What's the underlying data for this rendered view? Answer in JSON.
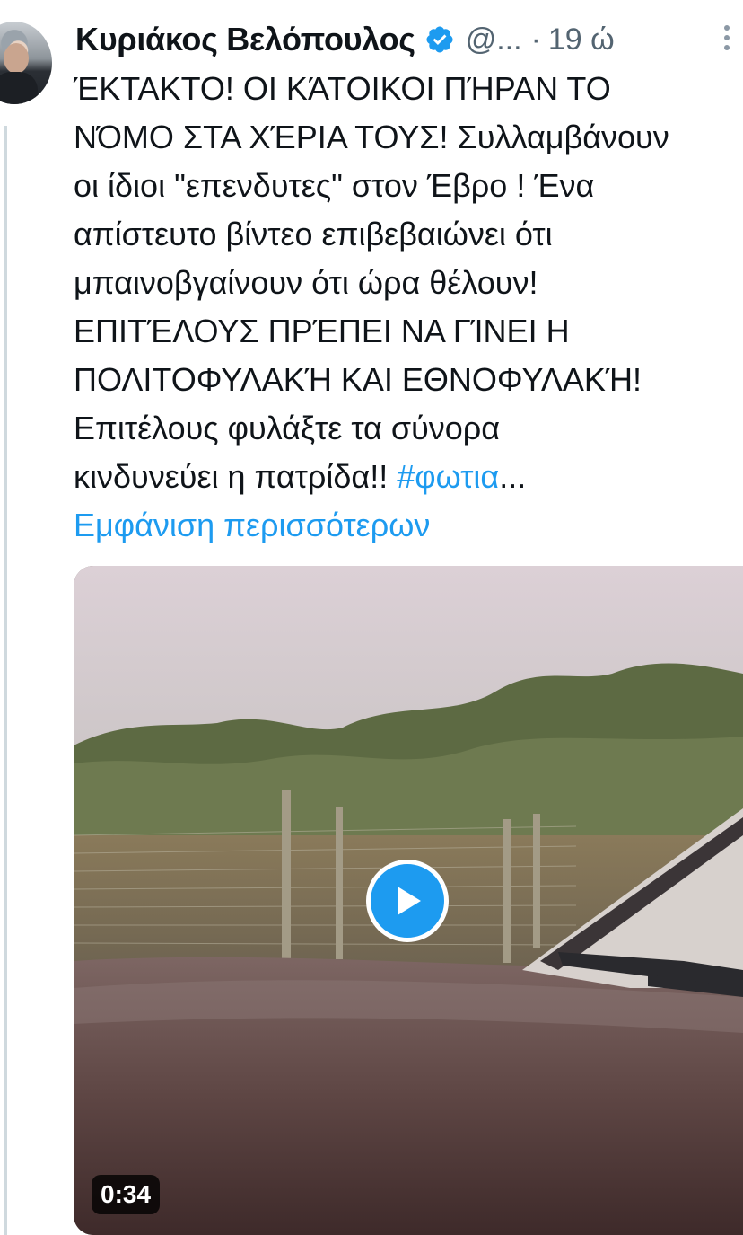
{
  "author": {
    "name": "Κυριάκος Βελόπουλος",
    "handle": "@...",
    "separator": "·",
    "time": "19 ώ",
    "verified_icon": "verified-badge-icon",
    "avatar": "profile-photo"
  },
  "tweet": {
    "lines": [
      "ΈΚΤΑΚΤΟ! ΟΙ ΚΆΤΟΙΚΟΙ ΠΉΡΑΝ ΤΟ",
      "ΝΌΜΟ ΣΤΑ ΧΈΡΙΑ ΤΟΥΣ! Συλλαμβάνουν",
      "οι ίδιοι \"επενδυτες\" στον Έβρο ! Ένα",
      "απίστευτο βίντεο επιβεβαιώνει ότι",
      "μπαινοβγαίνουν ότι ώρα θέλουν!",
      "ΕΠΙΤΈΛΟΥΣ ΠΡΈΠΕΙ ΝΑ ΓΊΝΕΙ Η",
      "ΠΟΛΙΤΟΦΥΛΑΚΉ ΚΑΙ ΕΘΝΟΦΥΛΑΚΉ!",
      "Επιτέλους φυλάξτε τα σύνορα"
    ],
    "last_line_text": "κινδυνεύει η πατρίδα!! ",
    "hashtag": "#φωτια",
    "ellipsis": "...",
    "show_more": "Εμφάνιση περισσότερων"
  },
  "media": {
    "type": "video",
    "duration": "0:34",
    "play_icon": "play-icon"
  },
  "colors": {
    "link": "#1d9bf0",
    "text": "#0f1419",
    "secondary": "#536471"
  }
}
